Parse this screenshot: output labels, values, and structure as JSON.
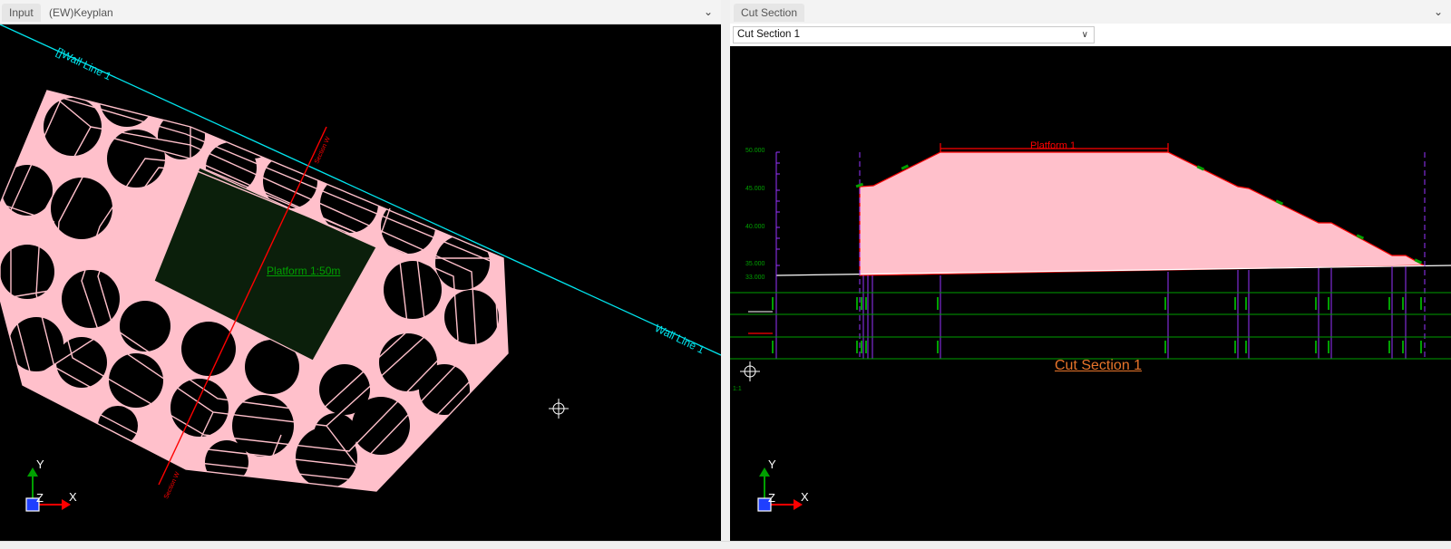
{
  "left": {
    "tabs": [
      {
        "label": "Input"
      },
      {
        "label": "(EW)Keyplan"
      }
    ],
    "labels": {
      "wall_line_top": "[]Wall Line 1",
      "wall_line_right": "Wall Line 1",
      "platform": "Platform 1:50m",
      "section_top": "Section W",
      "section_bottom": "Section W"
    },
    "axis": {
      "y": "Y",
      "z": "Z",
      "x": "X"
    },
    "colors": {
      "fill": "#ffc0cb",
      "wall": "#00e5ee",
      "section": "#ff0000",
      "platform": "#0b1f0b"
    }
  },
  "right": {
    "tabs": [
      {
        "label": "Cut Section"
      }
    ],
    "dropdown": {
      "value": "Cut Section 1"
    },
    "labels": {
      "platform": "Platform 1",
      "title": "Cut Section 1",
      "small": "1:1"
    },
    "elevations": [
      "50.000",
      "45.000",
      "40.000",
      "35.000",
      "33.000"
    ],
    "axis": {
      "y": "Y",
      "z": "Z",
      "x": "X"
    },
    "colors": {
      "fill": "#ffc0cb",
      "title": "#e8742a",
      "grid": "#00a000",
      "guide": "#9933ff"
    }
  }
}
